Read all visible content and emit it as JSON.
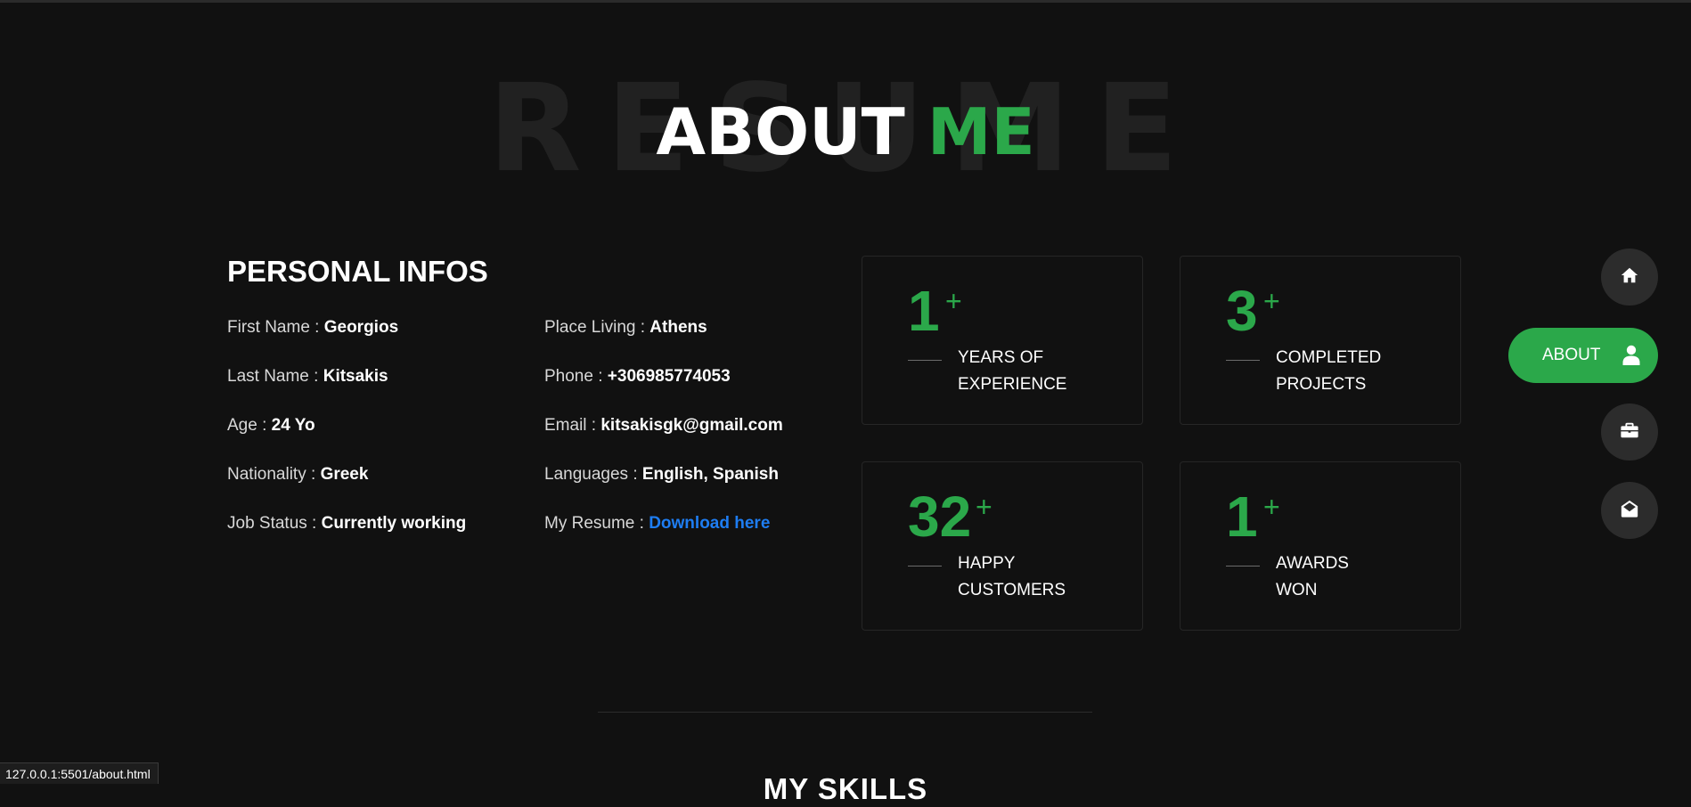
{
  "header": {
    "background_word": "RESUME",
    "title_main": "ABOUT",
    "title_accent": "ME",
    "accent_color": "#2ba84a"
  },
  "personal_infos": {
    "heading": "PERSONAL INFOS",
    "left": [
      {
        "label": "First Name :",
        "value": "Georgios"
      },
      {
        "label": "Last Name :",
        "value": "Kitsakis"
      },
      {
        "label": "Age :",
        "value": "24 Yo"
      },
      {
        "label": "Nationality :",
        "value": "Greek"
      },
      {
        "label": "Job Status :",
        "value": "Currently working"
      }
    ],
    "right": [
      {
        "label": "Place Living :",
        "value": "Athens"
      },
      {
        "label": "Phone :",
        "value": "+306985774053"
      },
      {
        "label": "Email :",
        "value": "kitsakisgk@gmail.com"
      },
      {
        "label": "Languages :",
        "value": "English, Spanish"
      },
      {
        "label": "My Resume :",
        "value": "Download here"
      }
    ],
    "link_color": "#1e7df2"
  },
  "stats": [
    {
      "number": "1",
      "plus": "+",
      "line1": "YEARS OF",
      "line2": "EXPERIENCE"
    },
    {
      "number": "3",
      "plus": "+",
      "line1": "COMPLETED",
      "line2": "PROJECTS"
    },
    {
      "number": "32",
      "plus": "+",
      "line1": "HAPPY",
      "line2": "CUSTOMERS"
    },
    {
      "number": "1",
      "plus": "+",
      "line1": "AWARDS",
      "line2": "WON"
    }
  ],
  "nav": {
    "items": [
      {
        "icon": "home-icon"
      },
      {
        "label": "ABOUT",
        "icon": "user-icon",
        "active": true
      },
      {
        "icon": "briefcase-icon"
      },
      {
        "icon": "envelope-open-icon"
      }
    ]
  },
  "skills": {
    "heading": "MY SKILLS"
  },
  "status_bar": {
    "url": "127.0.0.1:5501/about.html"
  }
}
